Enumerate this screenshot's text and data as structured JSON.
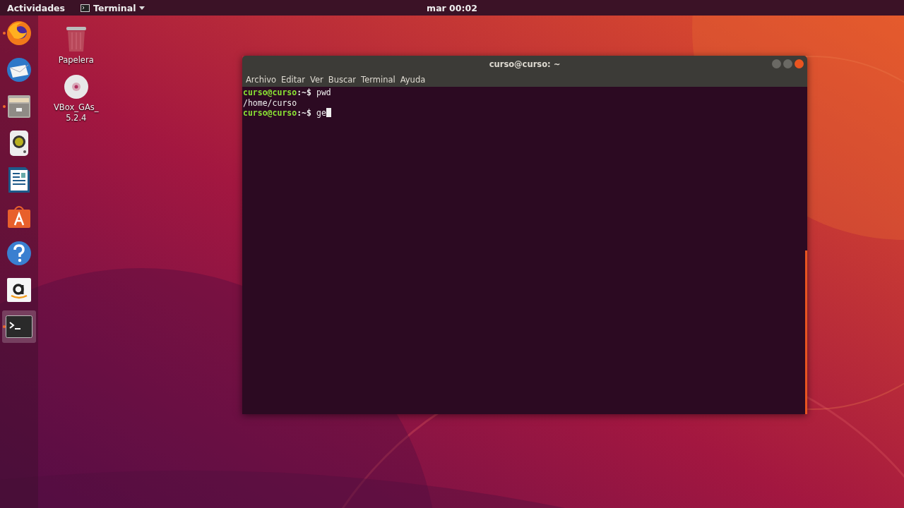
{
  "top_bar": {
    "activities": "Actividades",
    "app_menu": "Terminal",
    "clock": "mar 00:02"
  },
  "dock": [
    {
      "kind": "browser",
      "running": true,
      "selected": false
    },
    {
      "kind": "mail",
      "running": false,
      "selected": false
    },
    {
      "kind": "files",
      "running": true,
      "selected": false
    },
    {
      "kind": "speaker",
      "running": false,
      "selected": false
    },
    {
      "kind": "document",
      "running": false,
      "selected": false
    },
    {
      "kind": "store",
      "running": false,
      "selected": false
    },
    {
      "kind": "help",
      "running": false,
      "selected": false
    },
    {
      "kind": "amazon",
      "running": false,
      "selected": false
    },
    {
      "kind": "terminal",
      "running": true,
      "selected": true
    }
  ],
  "desktop_icons": [
    {
      "kind": "trash",
      "label": "Papelera"
    },
    {
      "kind": "disc",
      "label": "VBox_GAs_\n5.2.4"
    }
  ],
  "terminal_window": {
    "title": "curso@curso: ~",
    "menu": [
      "Archivo",
      "Editar",
      "Ver",
      "Buscar",
      "Terminal",
      "Ayuda"
    ],
    "lines": [
      {
        "kind": "prompt",
        "user_host": "curso@curso",
        "path": ":~$",
        "command": "pwd",
        "cursor": false
      },
      {
        "kind": "output",
        "text": "/home/curso"
      },
      {
        "kind": "prompt",
        "user_host": "curso@curso",
        "path": ":~$",
        "command": "ge",
        "cursor": true
      }
    ]
  }
}
